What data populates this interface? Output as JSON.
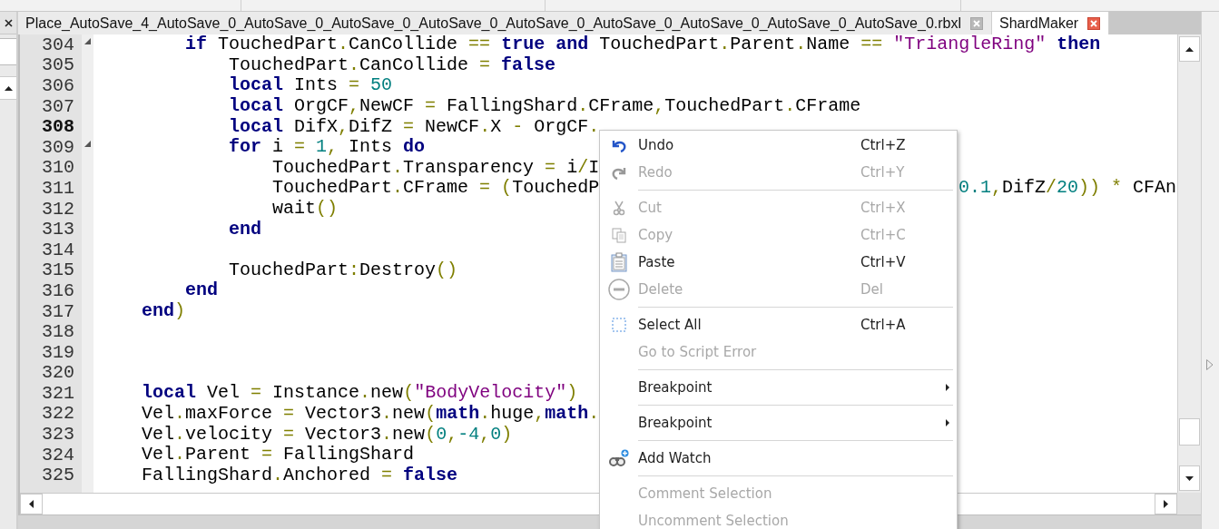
{
  "tabs": [
    {
      "label": "Place_AutoSave_4_AutoSave_0_AutoSave_0_AutoSave_0_AutoSave_0_AutoSave_0_AutoSave_0_AutoSave_0_AutoSave_0_AutoSave_0.rbxl",
      "selected": false
    },
    {
      "label": "ShardMaker",
      "selected": true
    }
  ],
  "editor": {
    "lines": [
      {
        "number": "304",
        "fold": true,
        "current": false,
        "tokens": [
          {
            "kind": "kw",
            "text": "        if"
          },
          {
            "kind": "id",
            "text": " TouchedPart"
          },
          {
            "kind": "op",
            "text": "."
          },
          {
            "kind": "id",
            "text": "CanCollide "
          },
          {
            "kind": "op",
            "text": "=="
          },
          {
            "kind": "kw",
            "text": " true"
          },
          {
            "kind": "kw",
            "text": " and"
          },
          {
            "kind": "id",
            "text": " TouchedPart"
          },
          {
            "kind": "op",
            "text": "."
          },
          {
            "kind": "id",
            "text": "Parent"
          },
          {
            "kind": "op",
            "text": "."
          },
          {
            "kind": "id",
            "text": "Name "
          },
          {
            "kind": "op",
            "text": "=="
          },
          {
            "kind": "str",
            "text": " \"TriangleRing\""
          },
          {
            "kind": "kw",
            "text": " then"
          }
        ]
      },
      {
        "number": "305",
        "fold": false,
        "current": false,
        "tokens": [
          {
            "kind": "id",
            "text": "            TouchedPart"
          },
          {
            "kind": "op",
            "text": "."
          },
          {
            "kind": "id",
            "text": "CanCollide "
          },
          {
            "kind": "op",
            "text": "="
          },
          {
            "kind": "kw",
            "text": " false"
          }
        ]
      },
      {
        "number": "306",
        "fold": false,
        "current": false,
        "tokens": [
          {
            "kind": "kw",
            "text": "            local"
          },
          {
            "kind": "id",
            "text": " Ints "
          },
          {
            "kind": "op",
            "text": "="
          },
          {
            "kind": "num",
            "text": " 50"
          }
        ]
      },
      {
        "number": "307",
        "fold": false,
        "current": false,
        "tokens": [
          {
            "kind": "kw",
            "text": "            local"
          },
          {
            "kind": "id",
            "text": " OrgCF"
          },
          {
            "kind": "op",
            "text": ","
          },
          {
            "kind": "id",
            "text": "NewCF "
          },
          {
            "kind": "op",
            "text": "="
          },
          {
            "kind": "id",
            "text": " FallingShard"
          },
          {
            "kind": "op",
            "text": "."
          },
          {
            "kind": "id",
            "text": "CFrame"
          },
          {
            "kind": "op",
            "text": ","
          },
          {
            "kind": "id",
            "text": "TouchedPart"
          },
          {
            "kind": "op",
            "text": "."
          },
          {
            "kind": "id",
            "text": "CFrame"
          }
        ]
      },
      {
        "number": "308",
        "fold": false,
        "current": true,
        "tokens": [
          {
            "kind": "kw",
            "text": "            local"
          },
          {
            "kind": "id",
            "text": " DifX"
          },
          {
            "kind": "op",
            "text": ","
          },
          {
            "kind": "id",
            "text": "DifZ "
          },
          {
            "kind": "op",
            "text": "="
          },
          {
            "kind": "id",
            "text": " NewCF"
          },
          {
            "kind": "op",
            "text": "."
          },
          {
            "kind": "id",
            "text": "X "
          },
          {
            "kind": "op",
            "text": "-"
          },
          {
            "kind": "id",
            "text": " OrgCF"
          },
          {
            "kind": "op",
            "text": "."
          }
        ]
      },
      {
        "number": "309",
        "fold": true,
        "current": false,
        "tokens": [
          {
            "kind": "kw",
            "text": "            for"
          },
          {
            "kind": "id",
            "text": " i "
          },
          {
            "kind": "op",
            "text": "="
          },
          {
            "kind": "num",
            "text": " 1"
          },
          {
            "kind": "op",
            "text": ","
          },
          {
            "kind": "id",
            "text": " Ints "
          },
          {
            "kind": "kw",
            "text": "do"
          }
        ]
      },
      {
        "number": "310",
        "fold": false,
        "current": false,
        "tokens": [
          {
            "kind": "id",
            "text": "                TouchedPart"
          },
          {
            "kind": "op",
            "text": "."
          },
          {
            "kind": "id",
            "text": "Transparency "
          },
          {
            "kind": "op",
            "text": "="
          },
          {
            "kind": "id",
            "text": " i"
          },
          {
            "kind": "op",
            "text": "/"
          },
          {
            "kind": "id",
            "text": "I"
          }
        ]
      },
      {
        "number": "311",
        "fold": false,
        "current": false,
        "tokens": [
          {
            "kind": "id",
            "text": "                TouchedPart"
          },
          {
            "kind": "op",
            "text": "."
          },
          {
            "kind": "id",
            "text": "CFrame "
          },
          {
            "kind": "op",
            "text": "="
          },
          {
            "kind": "op",
            "text": " ("
          },
          {
            "kind": "id",
            "text": "TouchedP"
          }
        ],
        "tail": [
          {
            "kind": "num",
            "text": "0.1"
          },
          {
            "kind": "op",
            "text": ","
          },
          {
            "kind": "id",
            "text": "DifZ"
          },
          {
            "kind": "op",
            "text": "/"
          },
          {
            "kind": "num",
            "text": "20"
          },
          {
            "kind": "op",
            "text": "))"
          },
          {
            "kind": "op",
            "text": " *"
          },
          {
            "kind": "id",
            "text": " CFAn"
          }
        ]
      },
      {
        "number": "312",
        "fold": false,
        "current": false,
        "tokens": [
          {
            "kind": "id",
            "text": "                wait"
          },
          {
            "kind": "op",
            "text": "()"
          }
        ]
      },
      {
        "number": "313",
        "fold": false,
        "current": false,
        "tokens": [
          {
            "kind": "kw",
            "text": "            end"
          }
        ]
      },
      {
        "number": "314",
        "fold": false,
        "current": false
      },
      {
        "number": "315",
        "fold": false,
        "current": false,
        "tokens": [
          {
            "kind": "id",
            "text": "            TouchedPart"
          },
          {
            "kind": "op",
            "text": ":"
          },
          {
            "kind": "id",
            "text": "Destroy"
          },
          {
            "kind": "op",
            "text": "()"
          }
        ]
      },
      {
        "number": "316",
        "fold": false,
        "current": false,
        "tokens": [
          {
            "kind": "kw",
            "text": "        end"
          }
        ]
      },
      {
        "number": "317",
        "fold": false,
        "current": false,
        "tokens": [
          {
            "kind": "kw",
            "text": "    end"
          },
          {
            "kind": "op",
            "text": ")"
          }
        ]
      },
      {
        "number": "318",
        "fold": false,
        "current": false
      },
      {
        "number": "319",
        "fold": false,
        "current": false
      },
      {
        "number": "320",
        "fold": false,
        "current": false
      },
      {
        "number": "321",
        "fold": false,
        "current": false,
        "tokens": [
          {
            "kind": "kw",
            "text": "    local"
          },
          {
            "kind": "id",
            "text": " Vel "
          },
          {
            "kind": "op",
            "text": "="
          },
          {
            "kind": "id",
            "text": " Instance"
          },
          {
            "kind": "op",
            "text": "."
          },
          {
            "kind": "id",
            "text": "new"
          },
          {
            "kind": "op",
            "text": "("
          },
          {
            "kind": "str",
            "text": "\"BodyVelocity\""
          },
          {
            "kind": "op",
            "text": ")"
          }
        ]
      },
      {
        "number": "322",
        "fold": false,
        "current": false,
        "tokens": [
          {
            "kind": "id",
            "text": "    Vel"
          },
          {
            "kind": "op",
            "text": "."
          },
          {
            "kind": "id",
            "text": "maxForce "
          },
          {
            "kind": "op",
            "text": "="
          },
          {
            "kind": "id",
            "text": " Vector3"
          },
          {
            "kind": "op",
            "text": "."
          },
          {
            "kind": "id",
            "text": "new"
          },
          {
            "kind": "op",
            "text": "("
          },
          {
            "kind": "kw",
            "text": "math"
          },
          {
            "kind": "op",
            "text": "."
          },
          {
            "kind": "id",
            "text": "huge"
          },
          {
            "kind": "op",
            "text": ","
          },
          {
            "kind": "kw",
            "text": "math"
          },
          {
            "kind": "op",
            "text": "."
          }
        ]
      },
      {
        "number": "323",
        "fold": false,
        "current": false,
        "tokens": [
          {
            "kind": "id",
            "text": "    Vel"
          },
          {
            "kind": "op",
            "text": "."
          },
          {
            "kind": "id",
            "text": "velocity "
          },
          {
            "kind": "op",
            "text": "="
          },
          {
            "kind": "id",
            "text": " Vector3"
          },
          {
            "kind": "op",
            "text": "."
          },
          {
            "kind": "id",
            "text": "new"
          },
          {
            "kind": "op",
            "text": "("
          },
          {
            "kind": "num",
            "text": "0"
          },
          {
            "kind": "op",
            "text": ","
          },
          {
            "kind": "num",
            "text": "-4"
          },
          {
            "kind": "op",
            "text": ","
          },
          {
            "kind": "num",
            "text": "0"
          },
          {
            "kind": "op",
            "text": ")"
          }
        ]
      },
      {
        "number": "324",
        "fold": false,
        "current": false,
        "tokens": [
          {
            "kind": "id",
            "text": "    Vel"
          },
          {
            "kind": "op",
            "text": "."
          },
          {
            "kind": "id",
            "text": "Parent "
          },
          {
            "kind": "op",
            "text": "="
          },
          {
            "kind": "id",
            "text": " FallingShard"
          }
        ]
      },
      {
        "number": "325",
        "fold": false,
        "current": false,
        "tokens": [
          {
            "kind": "id",
            "text": "    FallingShard"
          },
          {
            "kind": "op",
            "text": "."
          },
          {
            "kind": "id",
            "text": "Anchored "
          },
          {
            "kind": "op",
            "text": "="
          },
          {
            "kind": "kw",
            "text": " false"
          }
        ]
      }
    ]
  },
  "context_menu": {
    "items": [
      {
        "kind": "item",
        "label": "Undo",
        "shortcut": "Ctrl+Z",
        "disabled": false
      },
      {
        "kind": "item",
        "label": "Redo",
        "shortcut": "Ctrl+Y",
        "disabled": true
      },
      {
        "kind": "separator"
      },
      {
        "kind": "item",
        "label": "Cut",
        "shortcut": "Ctrl+X",
        "disabled": true
      },
      {
        "kind": "item",
        "label": "Copy",
        "shortcut": "Ctrl+C",
        "disabled": true
      },
      {
        "kind": "item",
        "label": "Paste",
        "shortcut": "Ctrl+V",
        "disabled": false
      },
      {
        "kind": "item",
        "label": "Delete",
        "shortcut": "Del",
        "disabled": true
      },
      {
        "kind": "separator"
      },
      {
        "kind": "item",
        "label": "Select All",
        "shortcut": "Ctrl+A",
        "disabled": false
      },
      {
        "kind": "item",
        "label": "Go to Script Error",
        "disabled": true
      },
      {
        "kind": "separator"
      },
      {
        "kind": "submenu",
        "label": "Breakpoint",
        "disabled": false
      },
      {
        "kind": "separator"
      },
      {
        "kind": "submenu",
        "label": "Breakpoint",
        "disabled": false
      },
      {
        "kind": "separator"
      },
      {
        "kind": "item",
        "label": "Add Watch",
        "disabled": false
      },
      {
        "kind": "separator"
      },
      {
        "kind": "item",
        "label": "Comment Selection",
        "disabled": true
      },
      {
        "kind": "item",
        "label": "Uncomment Selection",
        "disabled": true
      }
    ]
  }
}
